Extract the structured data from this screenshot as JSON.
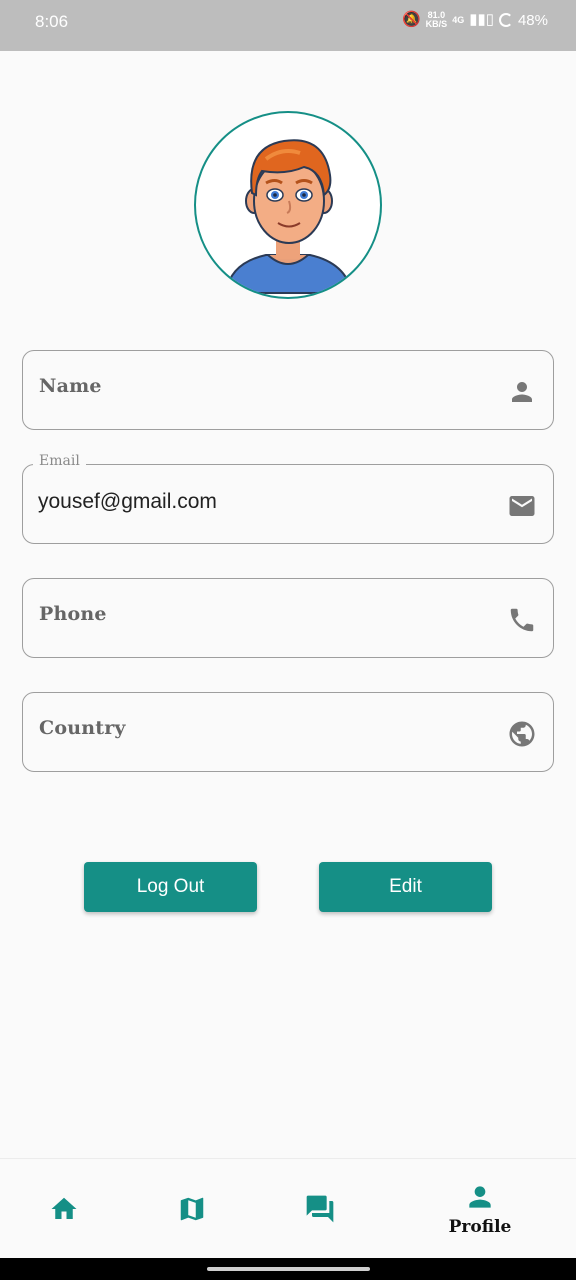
{
  "status_bar": {
    "time": "8:06",
    "net_speed_value": "81.0",
    "net_speed_unit": "KB/S",
    "network_type": "4G",
    "battery": "48%"
  },
  "profile": {
    "avatar_icon": "cartoon-boy-avatar"
  },
  "form": {
    "name": {
      "label": "Name",
      "icon": "person-icon"
    },
    "email": {
      "floating_label": "Email",
      "value": "yousef@gmail.com",
      "icon": "mail-icon"
    },
    "phone": {
      "label": "Phone",
      "icon": "phone-icon"
    },
    "country": {
      "label": "Country",
      "icon": "globe-icon"
    }
  },
  "actions": {
    "logout_label": "Log Out",
    "edit_label": "Edit"
  },
  "bottom_nav": {
    "items": [
      {
        "icon": "home-icon",
        "label": ""
      },
      {
        "icon": "map-icon",
        "label": ""
      },
      {
        "icon": "chat-icon",
        "label": ""
      },
      {
        "icon": "profile-icon",
        "label": "Profile"
      }
    ]
  },
  "colors": {
    "accent": "#158f86",
    "field_border": "#9e9e9e",
    "icon_gray": "#777777"
  }
}
